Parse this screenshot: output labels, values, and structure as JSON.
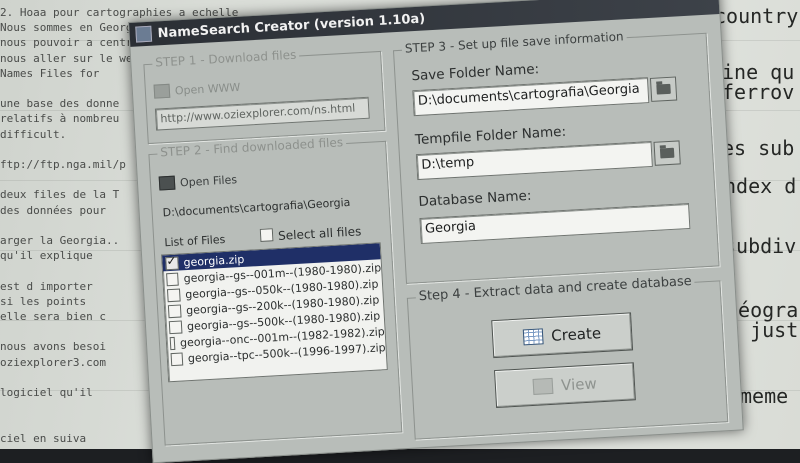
{
  "window": {
    "title": "NameSearch Creator (version 1.10a)"
  },
  "step1": {
    "title": "STEP 1 - Download files",
    "open_www_label": "Open WWW",
    "url": "http://www.oziexplorer.com/ns.html"
  },
  "step2": {
    "title": "STEP 2 - Find downloaded files",
    "open_files_label": "Open Files",
    "folder_path": "D:\\documents\\cartografia\\Georgia",
    "list_label": "List of Files",
    "select_all_label": "Select all files",
    "files": [
      {
        "name": "georgia.zip",
        "checked": true,
        "selected": true
      },
      {
        "name": "georgia--gs--001m--(1980-1980).zip",
        "checked": false,
        "selected": false
      },
      {
        "name": "georgia--gs--050k--(1980-1980).zip",
        "checked": false,
        "selected": false
      },
      {
        "name": "georgia--gs--200k--(1980-1980).zip",
        "checked": false,
        "selected": false
      },
      {
        "name": "georgia--gs--500k--(1980-1980).zip",
        "checked": false,
        "selected": false
      },
      {
        "name": "georgia--onc--001m--(1982-1982).zip",
        "checked": false,
        "selected": false
      },
      {
        "name": "georgia--tpc--500k--(1996-1997).zip",
        "checked": false,
        "selected": false
      }
    ]
  },
  "step3": {
    "title": "STEP 3 - Set up file save information",
    "save_folder_label": "Save Folder Name:",
    "save_folder_value": "D:\\documents\\cartografia\\Georgia",
    "temp_folder_label": "Tempfile Folder Name:",
    "temp_folder_value": "D:\\temp",
    "database_label": "Database Name:",
    "database_value": "Georgia"
  },
  "step4": {
    "title": "Step 4 - Extract data and create database",
    "create_label": "Create",
    "view_label": "View"
  },
  "background": {
    "right_texts": [
      "country",
      "ine qu",
      "ferrov",
      "es sub",
      "ndex d",
      "subdiv",
      "géogra",
      "n just",
      "meme"
    ],
    "left_lines": [
      "2. Hoaa pour cartographies a echelle",
      "Nous sommes en Georgia et nous avons a verifier une carte",
      "nous pouvoir a centre de la ville de Tiblisi",
      "nous aller sur le web",
      "Names Files for",
      "",
      "une base des donne",
      "relatifs à nombreu",
      "difficult.",
      "",
      "ftp://ftp.nga.mil/p",
      "",
      "deux files de la T",
      "des données pour",
      "",
      "arger la Georgia..",
      "qu'il explique",
      "",
      "est d importer",
      "si les points",
      "elle sera bien c",
      "",
      "nous avons besoi",
      "oziexplorer3.com",
      "",
      "logiciel qu'il",
      "",
      "",
      "ciel en suiva"
    ]
  }
}
